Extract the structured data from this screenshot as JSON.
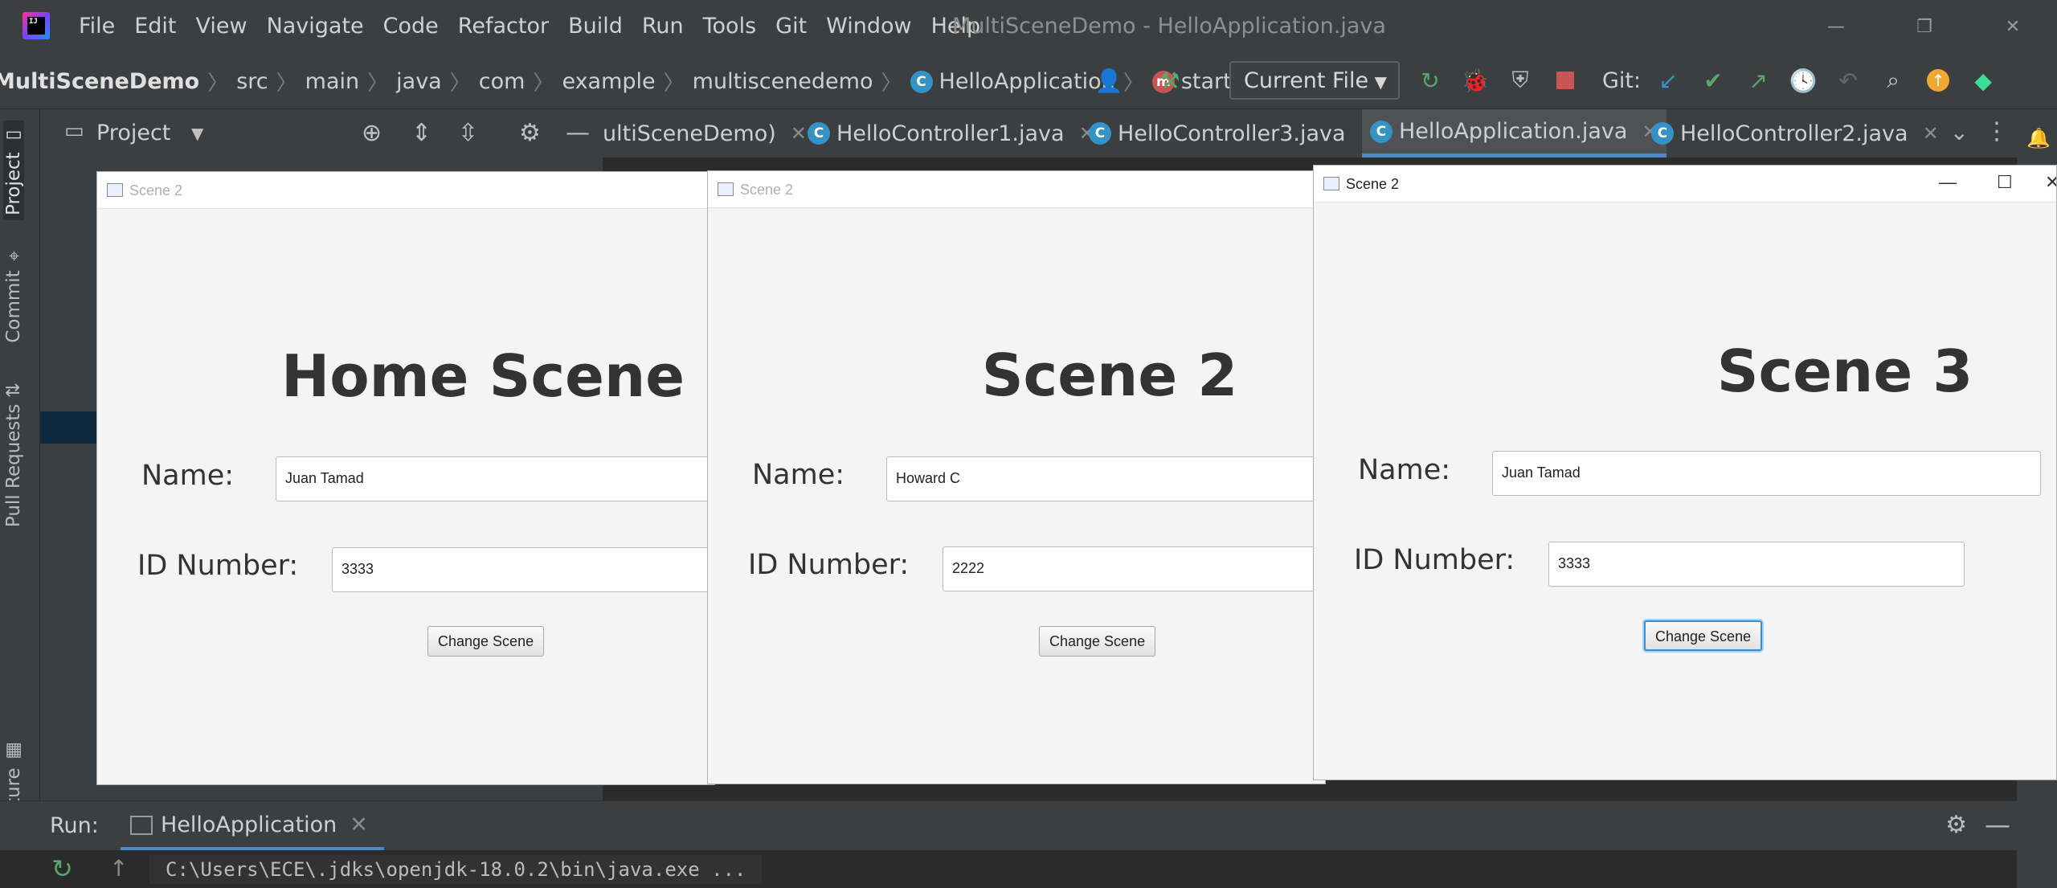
{
  "ide": {
    "logo_text": "IJ",
    "menu": [
      "File",
      "Edit",
      "View",
      "Navigate",
      "Code",
      "Refactor",
      "Build",
      "Run",
      "Tools",
      "Git",
      "Window",
      "Help"
    ],
    "window_title": "MultiSceneDemo - HelloApplication.java",
    "breadcrumbs": [
      "MultiSceneDemo",
      "src",
      "main",
      "java",
      "com",
      "example",
      "multiscenedemo",
      "HelloApplication",
      "start"
    ],
    "run_config": "Current File",
    "git_label": "Git:",
    "project_label": "Project",
    "tabs": [
      "ultiSceneDemo)",
      "HelloController1.java",
      "HelloController3.java",
      "HelloApplication.java",
      "HelloController2.java"
    ],
    "side_tabs": [
      "Project",
      "Commit",
      "Pull Requests",
      "Structure"
    ],
    "run": {
      "label": "Run:",
      "tab": "HelloApplication",
      "command": "C:\\Users\\ECE\\.jdks\\openjdk-18.0.2\\bin\\java.exe ..."
    },
    "colors": {
      "accent": "#4a88c7",
      "panel": "#3c3f41",
      "editor": "#2b2b2b"
    }
  },
  "windows": [
    {
      "title": "Scene 2",
      "heading": "Home Scene",
      "name_label": "Name:",
      "name_value": "Juan Tamad",
      "id_label": "ID Number:",
      "id_value": "3333",
      "button": "Change Scene"
    },
    {
      "title": "Scene 2",
      "heading": "Scene 2",
      "name_label": "Name:",
      "name_value": "Howard C",
      "id_label": "ID Number:",
      "id_value": "2222",
      "button": "Change Scene"
    },
    {
      "title": "Scene 2",
      "heading": "Scene 3",
      "name_label": "Name:",
      "name_value": "Juan Tamad",
      "id_label": "ID Number:",
      "id_value": "3333",
      "button": "Change Scene"
    }
  ]
}
